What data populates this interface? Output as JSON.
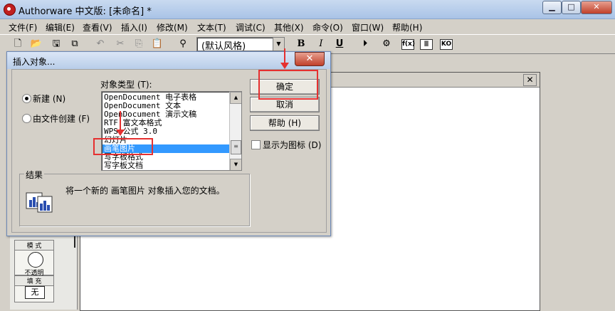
{
  "window": {
    "title": "Authorware 中文版: [未命名] *",
    "controls": {
      "minimize": "▁",
      "maximize": "□",
      "close": "✕"
    }
  },
  "menubar": {
    "items": [
      "文件(F)",
      "编辑(E)",
      "查看(V)",
      "插入(I)",
      "修改(M)",
      "文本(T)",
      "调试(C)",
      "其他(X)",
      "命令(O)",
      "窗口(W)",
      "帮助(H)"
    ]
  },
  "toolbar": {
    "style_value": "(默认风格)",
    "bold": "B",
    "italic": "I",
    "underline": "U",
    "box_f": "f(x)",
    "box_list": "≣",
    "box_ko": "KO"
  },
  "design_window": {
    "close": "✕"
  },
  "tools_panel": {
    "mode_header": "模 式",
    "mode_value": "不透明",
    "fill_header": "填 充",
    "fill_value": "无"
  },
  "dialog": {
    "title": "插入对象...",
    "close": "✕",
    "radio_new": "新建 (N)",
    "radio_file": "由文件创建 (F)",
    "object_type_label": "对象类型 (T):",
    "object_types": [
      "OpenDocument 电子表格",
      "OpenDocument 文本",
      "OpenDocument 演示文稿",
      "RTF 富文本格式",
      "WPS 公式 3.0",
      "幻灯片",
      "画笔图片",
      "写字板格式",
      "写字板文档"
    ],
    "selected_index": 6,
    "ok_button": "确定",
    "cancel_button": "取消",
    "help_button": "帮助 (H)",
    "display_as_icon": "显示为图标 (D)",
    "result_label": "结果",
    "result_text": "将一个新的 画笔图片 对象插入您的文档。"
  },
  "colors": {
    "annotation": "#e53030",
    "selection": "#3399ff"
  }
}
